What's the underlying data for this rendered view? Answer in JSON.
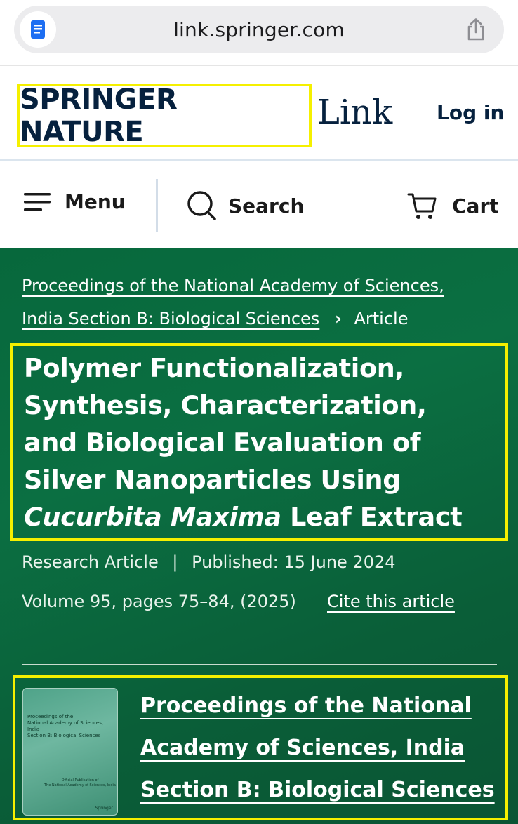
{
  "browser": {
    "url": "link.springer.com",
    "reader_icon": "document-icon",
    "share_icon": "share-icon"
  },
  "header": {
    "logo": "SPRINGER NATURE",
    "logo_suffix": "Link",
    "login_label": "Log in"
  },
  "nav": {
    "menu_label": "Menu",
    "search_label": "Search",
    "cart_label": "Cart"
  },
  "breadcrumb": {
    "journal_line1": "Proceedings of the National Academy of Sciences,",
    "journal_line2": "India Section B: Biological Sciences",
    "separator": "›",
    "current": "Article"
  },
  "article": {
    "title_line1": "Polymer Functionalization,",
    "title_line2": "Synthesis, Characterization,",
    "title_line3": "and Biological Evaluation of",
    "title_line4": "Silver Nanoparticles Using",
    "title_line5_italic": "Cucurbita Maxima",
    "title_line5_rest": " Leaf Extract",
    "type": "Research Article",
    "meta_separator": "|",
    "published": "Published: 15 June 2024",
    "volume": "Volume 95, pages 75–84, (2025)",
    "cite_label": "Cite this article"
  },
  "journal": {
    "line1": "Proceedings of the National",
    "line2": "Academy of Sciences, India",
    "line3": "Section B: Biological Sciences",
    "cover": {
      "title_line1": "Proceedings of the",
      "title_line2": "National Academy of Sciences,",
      "title_line3": "India",
      "title_line4": "Section B: Biological Sciences",
      "small_line1": "Official Publication of",
      "small_line2": "The National Academy of Sciences, India",
      "publisher": "Springer"
    }
  },
  "colors": {
    "brand_navy": "#06213e",
    "hero_green": "#07683c",
    "highlight_yellow": "#f5f000"
  }
}
